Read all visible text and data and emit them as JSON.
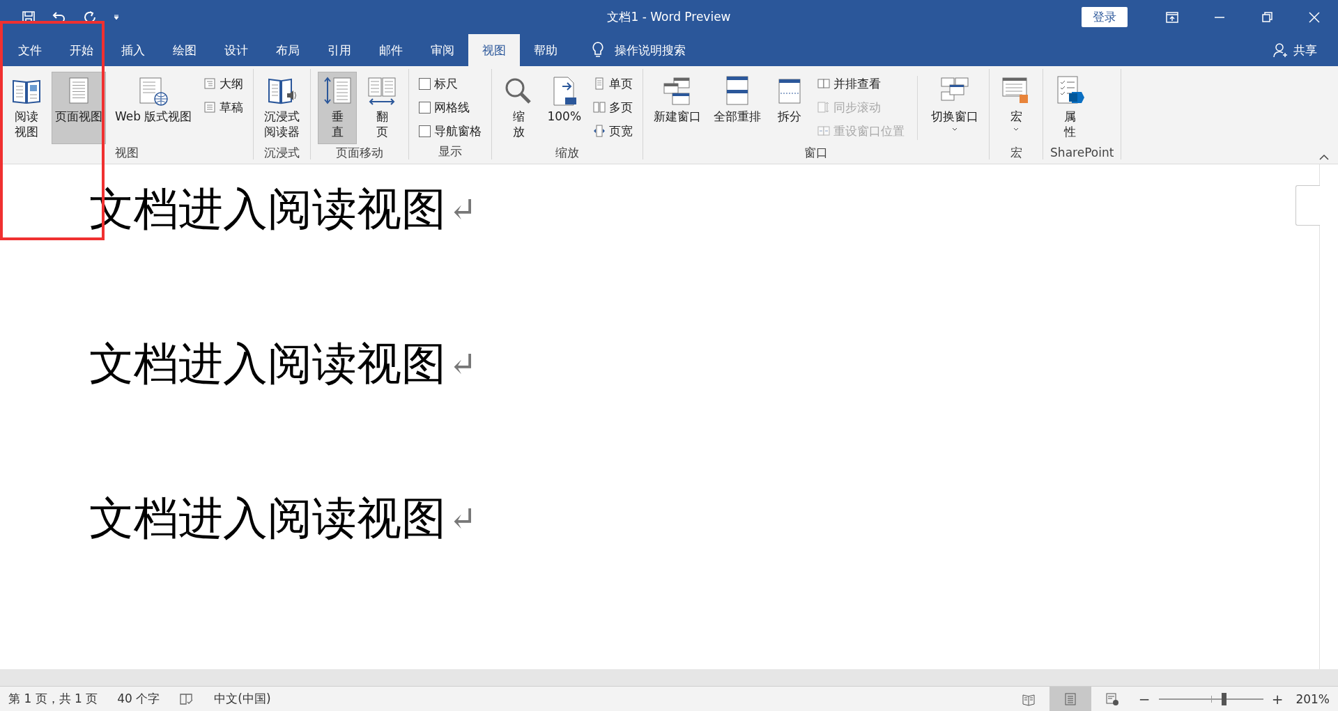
{
  "title_bar": {
    "title": "文档1  -  Word Preview",
    "login_button": "登录"
  },
  "tabs": [
    {
      "label": "文件",
      "selected": false
    },
    {
      "label": "开始",
      "selected": false
    },
    {
      "label": "插入",
      "selected": false
    },
    {
      "label": "绘图",
      "selected": false
    },
    {
      "label": "设计",
      "selected": false
    },
    {
      "label": "布局",
      "selected": false
    },
    {
      "label": "引用",
      "selected": false
    },
    {
      "label": "邮件",
      "selected": false
    },
    {
      "label": "审阅",
      "selected": false
    },
    {
      "label": "视图",
      "selected": true
    },
    {
      "label": "帮助",
      "selected": false
    }
  ],
  "tell_me": "操作说明搜索",
  "share": "共享",
  "ribbon": {
    "groups": [
      {
        "label": "视图",
        "items": [
          {
            "kind": "toggle",
            "lines": [
              "阅读",
              "视图"
            ],
            "selected": false
          },
          {
            "kind": "toggle",
            "lines": [
              "页面视图"
            ],
            "selected": true
          },
          {
            "kind": "toggle",
            "lines": [
              "Web 版式视图"
            ],
            "selected": false
          },
          {
            "kind": "stack",
            "items": [
              {
                "label": "大纲",
                "disabled": false
              },
              {
                "label": "草稿",
                "disabled": false
              }
            ]
          }
        ]
      },
      {
        "label": "沉浸式",
        "items": [
          {
            "kind": "large",
            "lines": [
              "沉浸式",
              "阅读器"
            ]
          }
        ]
      },
      {
        "label": "页面移动",
        "items": [
          {
            "kind": "toggle",
            "lines": [
              "垂",
              "直"
            ],
            "selected": true
          },
          {
            "kind": "toggle",
            "lines": [
              "翻",
              "页"
            ],
            "selected": false
          }
        ]
      },
      {
        "label": "显示",
        "items": [
          {
            "kind": "checks",
            "items": [
              {
                "label": "标尺",
                "checked": false
              },
              {
                "label": "网格线",
                "checked": false
              },
              {
                "label": "导航窗格",
                "checked": false
              }
            ]
          }
        ]
      },
      {
        "label": "缩放",
        "items": [
          {
            "kind": "large",
            "lines": [
              "缩",
              "放"
            ]
          },
          {
            "kind": "large",
            "lines": [
              "100%"
            ]
          },
          {
            "kind": "stack",
            "items": [
              {
                "label": "单页",
                "disabled": false
              },
              {
                "label": "多页",
                "disabled": false
              },
              {
                "label": "页宽",
                "disabled": false
              }
            ]
          }
        ]
      },
      {
        "label": "窗口",
        "items": [
          {
            "kind": "large",
            "lines": [
              "新建窗口"
            ]
          },
          {
            "kind": "large",
            "lines": [
              "全部重排"
            ]
          },
          {
            "kind": "large",
            "lines": [
              "拆分"
            ]
          },
          {
            "kind": "stack",
            "items": [
              {
                "label": "并排查看",
                "disabled": false
              },
              {
                "label": "同步滚动",
                "disabled": true
              },
              {
                "label": "重设窗口位置",
                "disabled": true
              }
            ]
          },
          {
            "kind": "large",
            "lines": [
              "切换窗口"
            ],
            "dropdown": true
          }
        ]
      },
      {
        "label": "宏",
        "items": [
          {
            "kind": "large",
            "lines": [
              "宏"
            ],
            "dropdown": true
          }
        ]
      },
      {
        "label": "SharePoint",
        "items": [
          {
            "kind": "large",
            "lines": [
              "属",
              "性"
            ]
          }
        ]
      }
    ]
  },
  "document": {
    "paragraphs": [
      {
        "text": "文档进入阅读视图",
        "mark": "↵"
      },
      {
        "text": "文档进入阅读视图",
        "mark": "↵"
      },
      {
        "text": "文档进入阅读视图",
        "mark": "↵"
      }
    ]
  },
  "status_bar": {
    "page": "第 1 页，共 1 页",
    "words": "40 个字",
    "language": "中文(中国)",
    "views": [
      {
        "selected": false
      },
      {
        "selected": true
      },
      {
        "selected": false
      }
    ],
    "zoom": {
      "minus": "−",
      "plus": "+",
      "level": 0.625,
      "reading": "201%"
    }
  },
  "annotations": [
    {
      "kind": "highlight-frame"
    }
  ]
}
